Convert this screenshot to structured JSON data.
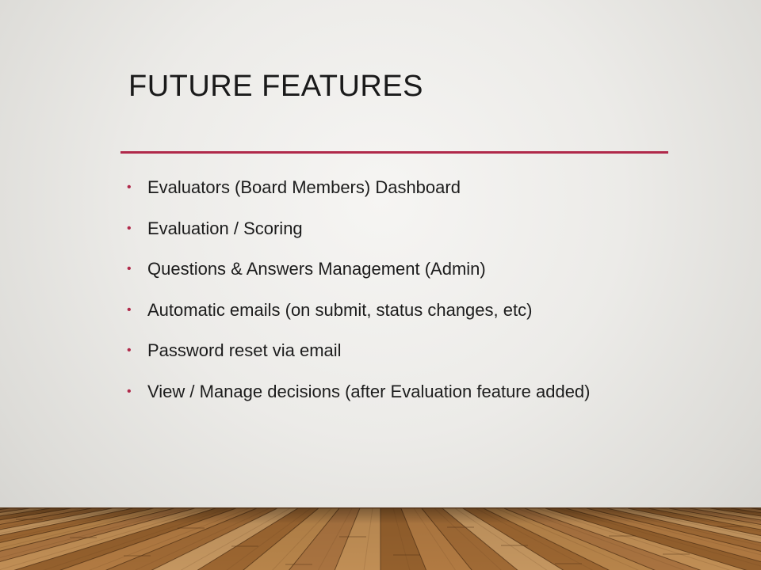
{
  "slide": {
    "title": "FUTURE FEATURES",
    "accent_color": "#b0294a",
    "bullet_glyph": "•",
    "bullets": [
      "Evaluators (Board Members) Dashboard",
      "Evaluation / Scoring",
      "Questions & Answers Management (Admin)",
      "Automatic emails (on submit, status changes, etc)",
      "Password reset via email",
      "View / Manage decisions (after Evaluation feature added)"
    ]
  }
}
